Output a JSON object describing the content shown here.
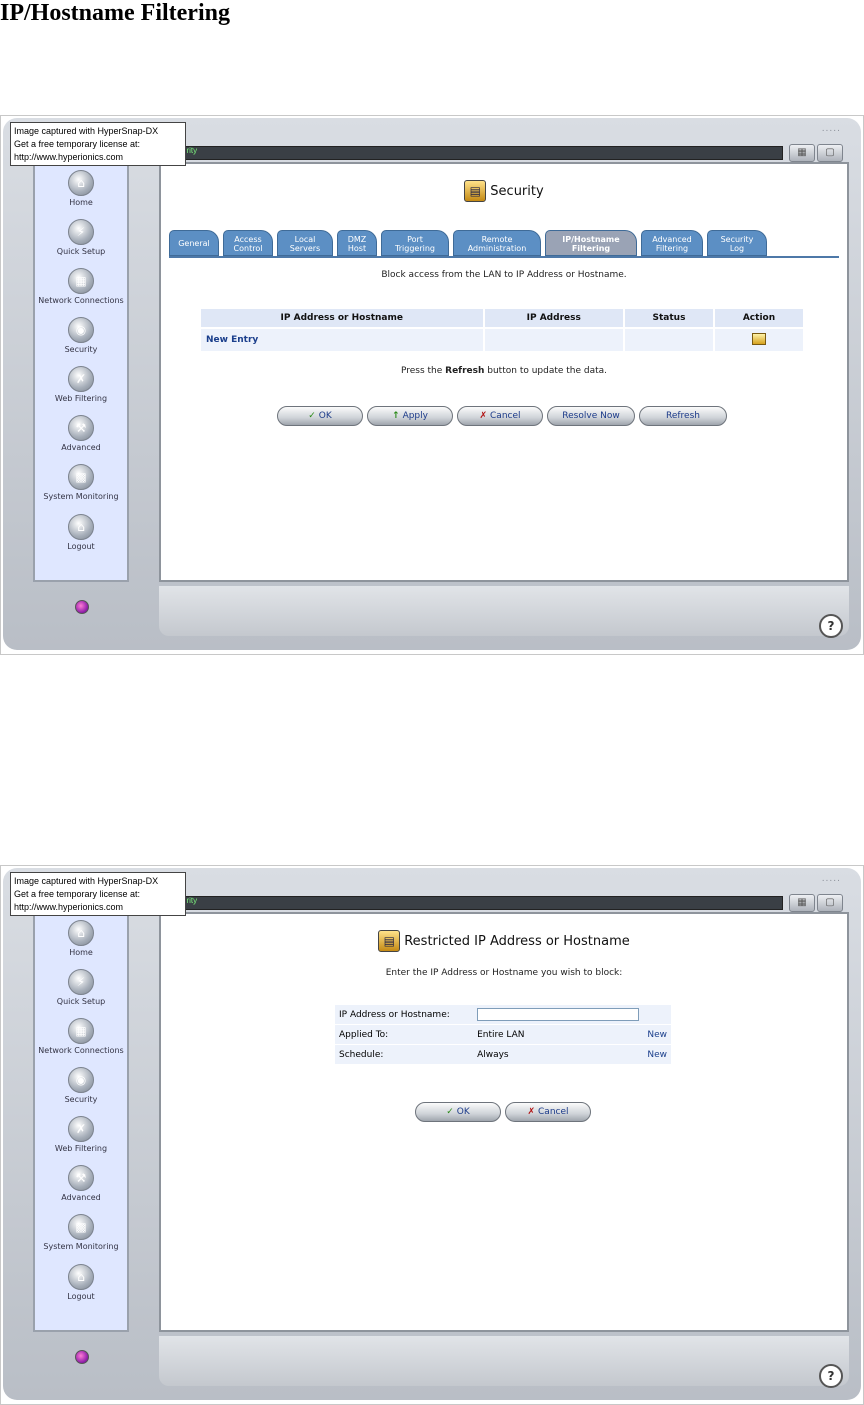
{
  "doc_title": "IP/Hostname Filtering",
  "watermark": {
    "line1": "Image captured with HyperSnap-DX",
    "line2": "Get a free temporary license at:",
    "line3": "http://www.hyperionics.com"
  },
  "topbar_text": "urity",
  "sidebar": {
    "items": [
      {
        "label": "Home",
        "icon": "home-icon"
      },
      {
        "label": "Quick Setup",
        "icon": "lightning-icon"
      },
      {
        "label": "Network Connections",
        "icon": "network-icon"
      },
      {
        "label": "Security",
        "icon": "lock-icon"
      },
      {
        "label": "Web Filtering",
        "icon": "filter-icon"
      },
      {
        "label": "Advanced",
        "icon": "tools-icon"
      },
      {
        "label": "System Monitoring",
        "icon": "monitor-icon"
      },
      {
        "label": "Logout",
        "icon": "logout-icon"
      }
    ]
  },
  "screen1": {
    "title": "Security",
    "tabs": [
      {
        "line1": "General",
        "line2": ""
      },
      {
        "line1": "Access",
        "line2": "Control"
      },
      {
        "line1": "Local",
        "line2": "Servers"
      },
      {
        "line1": "DMZ",
        "line2": "Host"
      },
      {
        "line1": "Port",
        "line2": "Triggering"
      },
      {
        "line1": "Remote",
        "line2": "Administration"
      },
      {
        "line1": "IP/Hostname",
        "line2": "Filtering"
      },
      {
        "line1": "Advanced",
        "line2": "Filtering"
      },
      {
        "line1": "Security",
        "line2": "Log"
      }
    ],
    "description": "Block access from the LAN to IP Address or Hostname.",
    "table": {
      "headers": [
        "IP Address or Hostname",
        "IP Address",
        "Status",
        "Action"
      ],
      "new_entry": "New Entry"
    },
    "refresh_note": {
      "before": "Press the ",
      "bold": "Refresh",
      "after": " button to update the data."
    },
    "buttons": {
      "ok": "OK",
      "apply": "Apply",
      "cancel": "Cancel",
      "resolve": "Resolve Now",
      "refresh": "Refresh"
    }
  },
  "screen2": {
    "title": "Restricted IP Address or Hostname",
    "description": "Enter the IP Address or Hostname you wish to block:",
    "rows": [
      {
        "label": "IP Address or Hostname:",
        "value": "",
        "link": ""
      },
      {
        "label": "Applied To:",
        "value": "Entire LAN",
        "link": "New"
      },
      {
        "label": "Schedule:",
        "value": "Always",
        "link": "New"
      }
    ],
    "buttons": {
      "ok": "OK",
      "cancel": "Cancel"
    }
  },
  "colors": {
    "tab": "#5c8fc4",
    "tab_active": "#9aa3b5",
    "sidebar_bg": "#dfe7ff",
    "link": "#1b3f8c"
  }
}
